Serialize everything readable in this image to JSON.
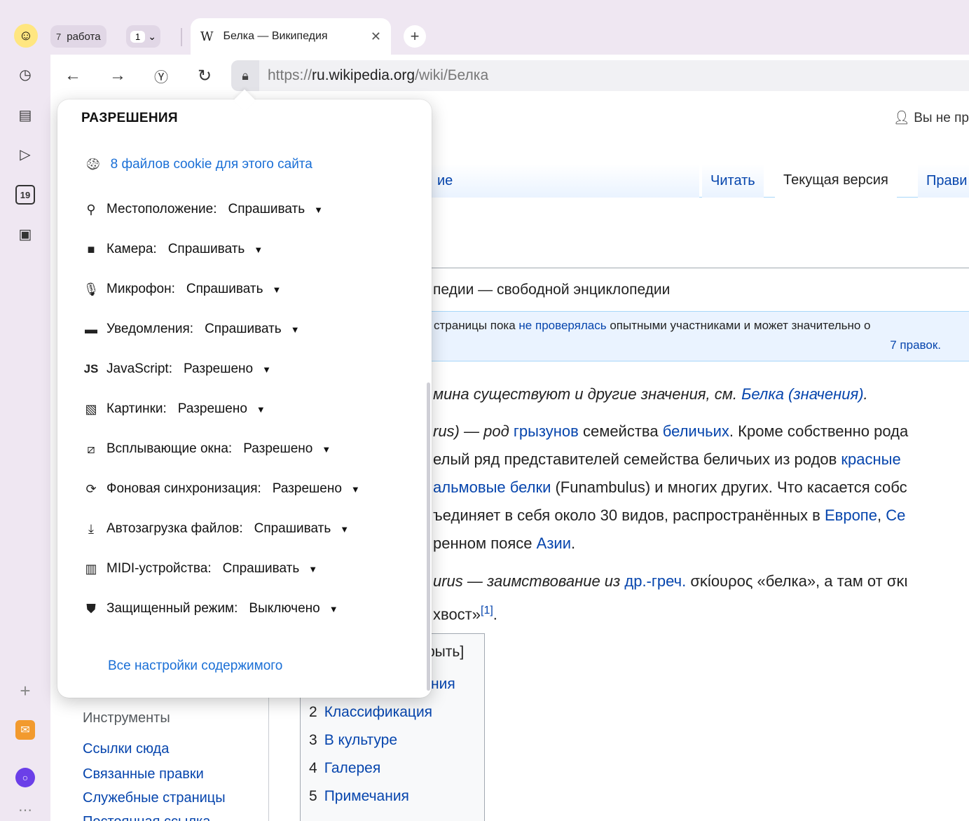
{
  "tabbar": {
    "group_count": "7",
    "group_name": "работа",
    "badge_count": "1",
    "tab_title": "Белка — Википедия",
    "tab_logo": "W"
  },
  "nav": {
    "url_scheme": "https://",
    "url_host": "ru.wikipedia.org",
    "url_path": "/wiki/Белка"
  },
  "sidebar": {
    "calendar_day": "19"
  },
  "page": {
    "user_status": "Вы не пр",
    "tab_partial": "ие",
    "tab_read": "Читать",
    "tab_current": "Текущая версия",
    "tab_edit": "Прави",
    "from": "педии — свободной энциклопедии",
    "notice_pre": "страницы пока ",
    "notice_link": "не проверялась",
    "notice_post": " опытными участниками и может значительно о",
    "notice_edits": "7 правок.",
    "hat_text": "мина существуют и другие значения, см. ",
    "hat_link": "Белка (значения)",
    "hat_end": ".",
    "p1_a": "rus) — род ",
    "p1_link1": "грызунов",
    "p1_b": " семейства ",
    "p1_link2": "беличьих",
    "p1_c": ". Кроме собственно рода",
    "p2_a": "елый ряд представителей семейства беличьих из родов ",
    "p2_link": "красные",
    "p3_link": "альмовые белки",
    "p3_a": " (Funambulus) и многих других. Что касается собс",
    "p4_a": "ъединяет в себя около 30 видов, распространённых в ",
    "p4_link1": "Европе",
    "p4_b": ", ",
    "p4_link2": "Се",
    "p5_a": "ренном поясе ",
    "p5_link": "Азии",
    "p5_b": ".",
    "p6_a": "urus — заимствование из ",
    "p6_link": "др.-греч.",
    "p6_b": " σκίουρος «белка», а там от σκι",
    "p7_a": "хвост»",
    "p7_ref": "[1]",
    "p7_b": ".",
    "toc_toggle": "рыть]",
    "toc_partial": "ния",
    "toc": [
      {
        "num": "2",
        "label": "Классификация"
      },
      {
        "num": "3",
        "label": "В культуре"
      },
      {
        "num": "4",
        "label": "Галерея"
      },
      {
        "num": "5",
        "label": "Примечания"
      }
    ],
    "tools_title": "Инструменты",
    "tools_links": [
      "Ссылки сюда",
      "Связанные правки",
      "Служебные страницы",
      "Постоянная ссылка"
    ]
  },
  "popup": {
    "title": "РАЗРЕШЕНИЯ",
    "cookies": "8 файлов cookie для этого сайта",
    "permissions": [
      {
        "icon": "location-icon",
        "label": "Местоположение:",
        "value": "Спрашивать"
      },
      {
        "icon": "camera-icon",
        "label": "Камера:",
        "value": "Спрашивать"
      },
      {
        "icon": "microphone-icon",
        "label": "Микрофон:",
        "value": "Спрашивать"
      },
      {
        "icon": "notification-icon",
        "label": "Уведомления:",
        "value": "Спрашивать"
      },
      {
        "icon": "javascript-icon",
        "label": "JavaScript:",
        "value": "Разрешено"
      },
      {
        "icon": "image-icon",
        "label": "Картинки:",
        "value": "Разрешено"
      },
      {
        "icon": "popup-icon",
        "label": "Всплывающие окна:",
        "value": "Разрешено"
      },
      {
        "icon": "sync-icon",
        "label": "Фоновая синхронизация:",
        "value": "Разрешено"
      },
      {
        "icon": "download-icon",
        "label": "Автозагрузка файлов:",
        "value": "Спрашивать"
      },
      {
        "icon": "midi-icon",
        "label": "MIDI-устройства:",
        "value": "Спрашивать"
      },
      {
        "icon": "shield-icon",
        "label": "Защищенный режим:",
        "value": "Выключено"
      }
    ],
    "all_settings": "Все настройки содержимого"
  }
}
